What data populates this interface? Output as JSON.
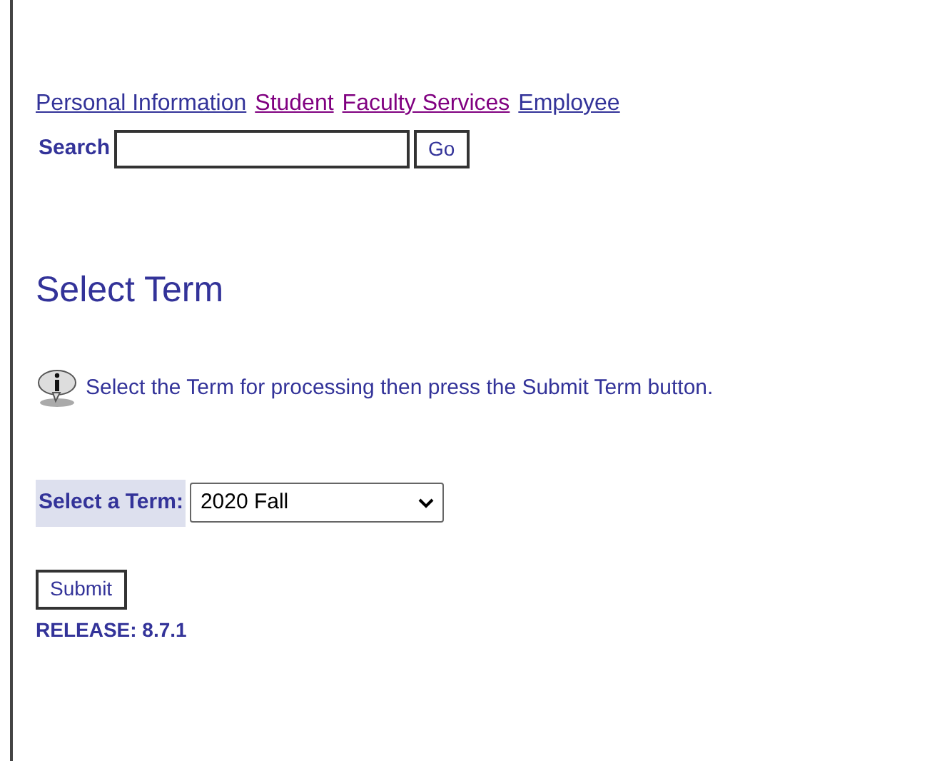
{
  "nav_links": [
    {
      "label": "Personal Information",
      "visited": false
    },
    {
      "label": "Student",
      "visited": true
    },
    {
      "label": "Faculty Services",
      "visited": true
    },
    {
      "label": "Employee",
      "visited": false
    }
  ],
  "search": {
    "label": "Search",
    "button": "Go"
  },
  "heading": "Select Term",
  "info_message": "Select the Term for processing then press the Submit Term button.",
  "term_select": {
    "label": "Select a Term:",
    "value": "2020 Fall"
  },
  "submit_button": "Submit",
  "release": "RELEASE: 8.7.1"
}
